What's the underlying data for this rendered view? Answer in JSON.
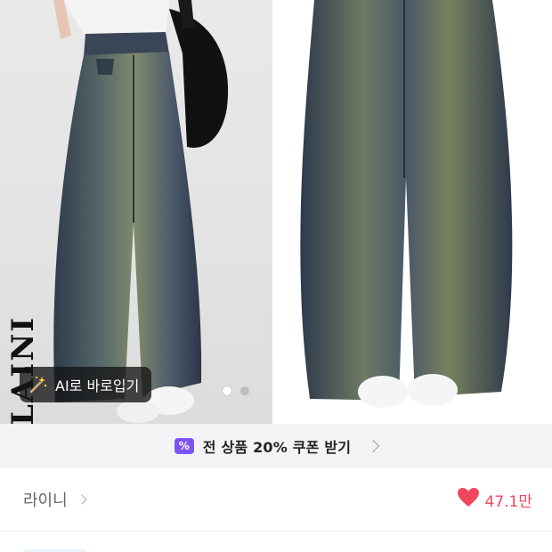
{
  "gallery": {
    "brand_text": "LAINI",
    "ai_button_label": "AI로 바로입기",
    "slide_count": 2,
    "active_slide": 1
  },
  "coupon": {
    "icon_text": "%",
    "label": "전 상품 20% 쿠폰 받기"
  },
  "store": {
    "name": "라이니",
    "like_count": "47.1만"
  },
  "colors": {
    "accent_purple": "#7d54f4",
    "heart_red": "#f0465e",
    "denim": "#3f4e63"
  }
}
